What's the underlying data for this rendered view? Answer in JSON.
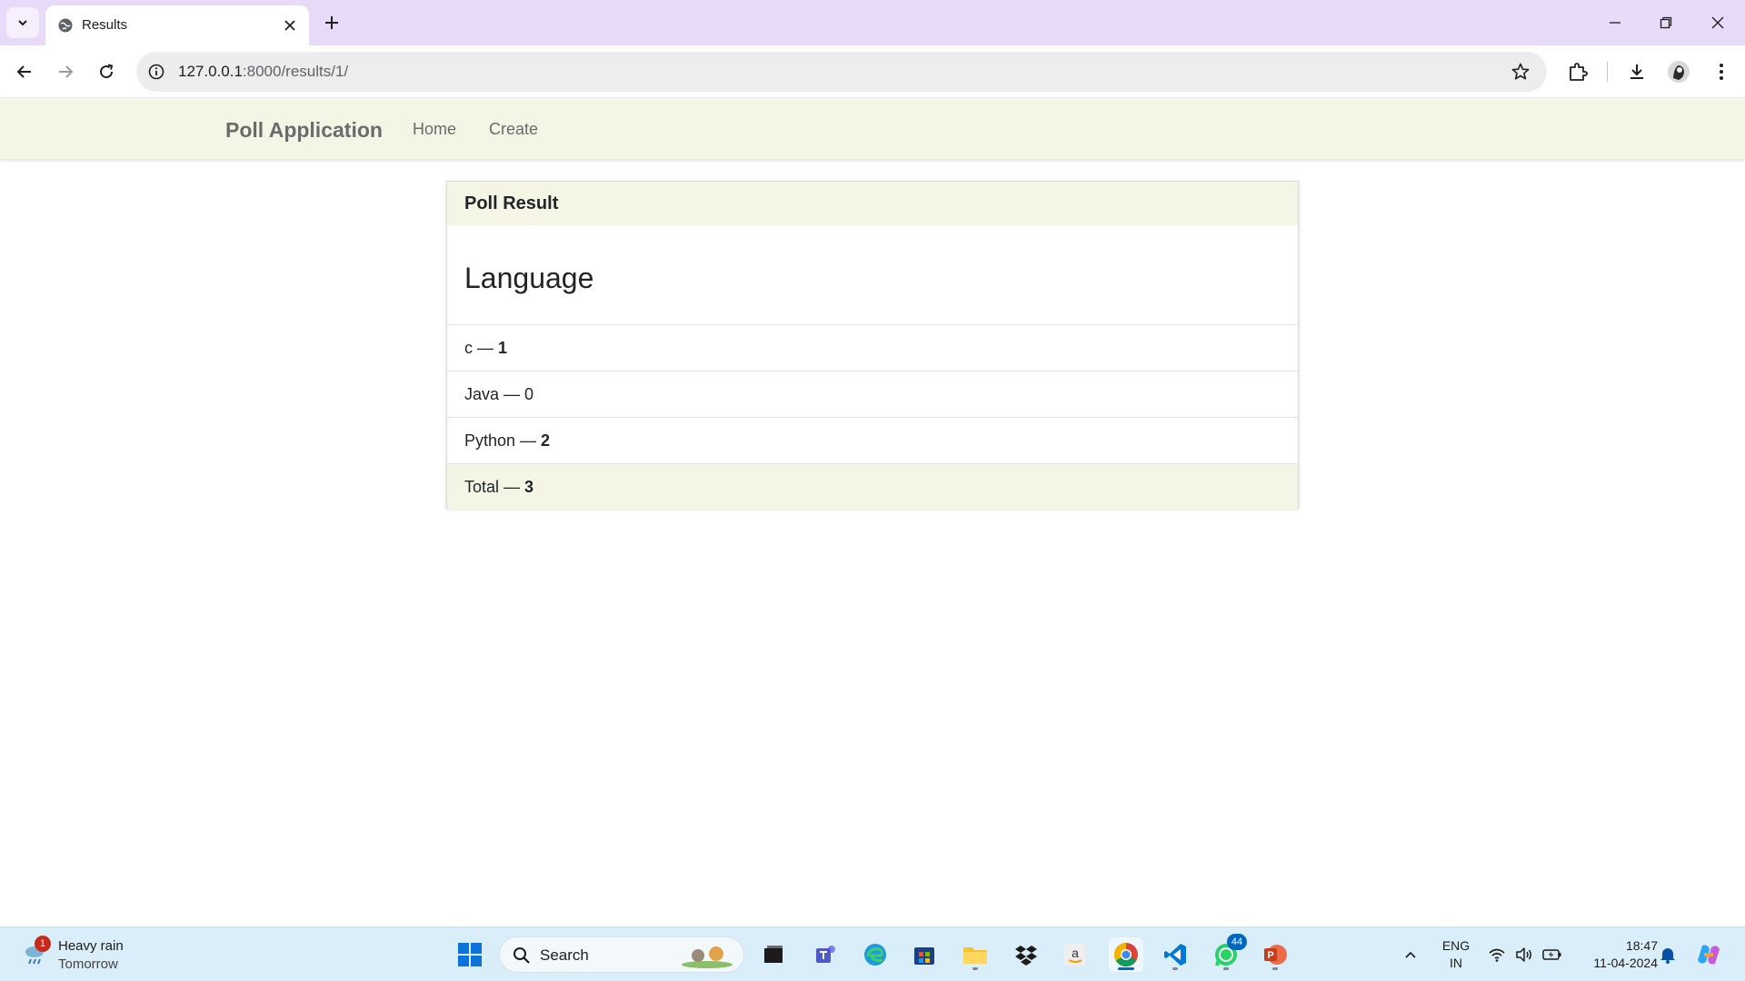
{
  "browser": {
    "tab": {
      "title": "Results"
    },
    "url": {
      "host": "127.0.0.1",
      "rest": ":8000/results/1/"
    }
  },
  "app": {
    "brand": "Poll Application",
    "nav": {
      "home": "Home",
      "create": "Create"
    }
  },
  "card": {
    "header": "Poll Result",
    "question": "Language",
    "results": [
      {
        "prefix": "c — ",
        "count": "1",
        "bold": true
      },
      {
        "prefix": "Java — 0",
        "count": "",
        "bold": false
      },
      {
        "prefix": "Python — ",
        "count": "2",
        "bold": true
      }
    ],
    "total": {
      "prefix": "Total — ",
      "count": "3"
    }
  },
  "taskbar": {
    "weather": {
      "badge": "1",
      "line1": "Heavy rain",
      "line2": "Tomorrow"
    },
    "search": {
      "placeholder": "Search"
    },
    "whatsapp_badge": "44",
    "language": {
      "line1": "ENG",
      "line2": "IN"
    },
    "clock": {
      "time": "18:47",
      "date": "11-04-2024"
    }
  }
}
